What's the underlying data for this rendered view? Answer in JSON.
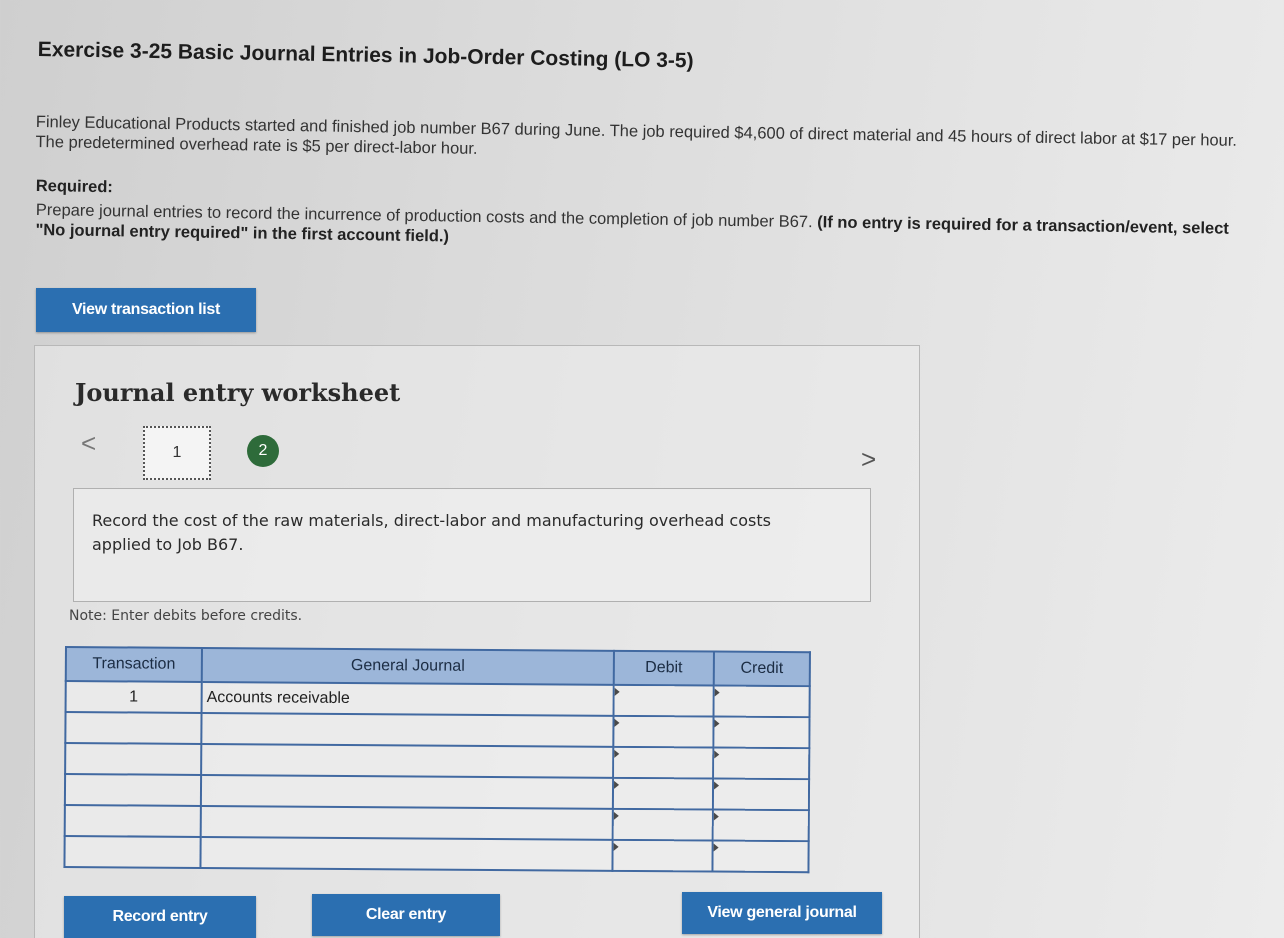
{
  "header": {
    "title": "Exercise 3-25 Basic Journal Entries in Job-Order Costing (LO 3-5)"
  },
  "problem": {
    "intro": "Finley Educational Products started and finished job number B67 during June. The job required $4,600 of direct material and 45 hours of direct labor at $17 per hour. The predetermined overhead rate is $5 per direct-labor hour.",
    "required_label": "Required:",
    "required_text": "Prepare journal entries to record the incurrence of production costs and the completion of job number B67.",
    "required_bold": "(If no entry is required for a transaction/event, select \"No journal entry required\" in the first account field.)"
  },
  "buttons": {
    "view_transaction_list": "View transaction list",
    "record_entry": "Record entry",
    "clear_entry": "Clear entry",
    "view_general_journal": "View general journal"
  },
  "worksheet": {
    "title": "Journal entry worksheet",
    "prev_glyph": "<",
    "next_glyph": ">",
    "steps": [
      "1",
      "2"
    ],
    "description": "Record the cost of the raw materials, direct-labor and manufacturing overhead costs applied to Job B67.",
    "note": "Note: Enter debits before credits."
  },
  "journal": {
    "headers": [
      "Transaction",
      "General Journal",
      "Debit",
      "Credit"
    ],
    "rows": [
      {
        "transaction": "1",
        "account": "Accounts receivable",
        "debit": "",
        "credit": ""
      },
      {
        "transaction": "",
        "account": "",
        "debit": "",
        "credit": ""
      },
      {
        "transaction": "",
        "account": "",
        "debit": "",
        "credit": ""
      },
      {
        "transaction": "",
        "account": "",
        "debit": "",
        "credit": ""
      },
      {
        "transaction": "",
        "account": "",
        "debit": "",
        "credit": ""
      },
      {
        "transaction": "",
        "account": "",
        "debit": "",
        "credit": ""
      }
    ]
  },
  "colors": {
    "button_bg": "#2b6fb1",
    "table_header_bg": "#9cb6d9",
    "table_border": "#4169a1",
    "step_active_bg": "#2e6b3a"
  }
}
